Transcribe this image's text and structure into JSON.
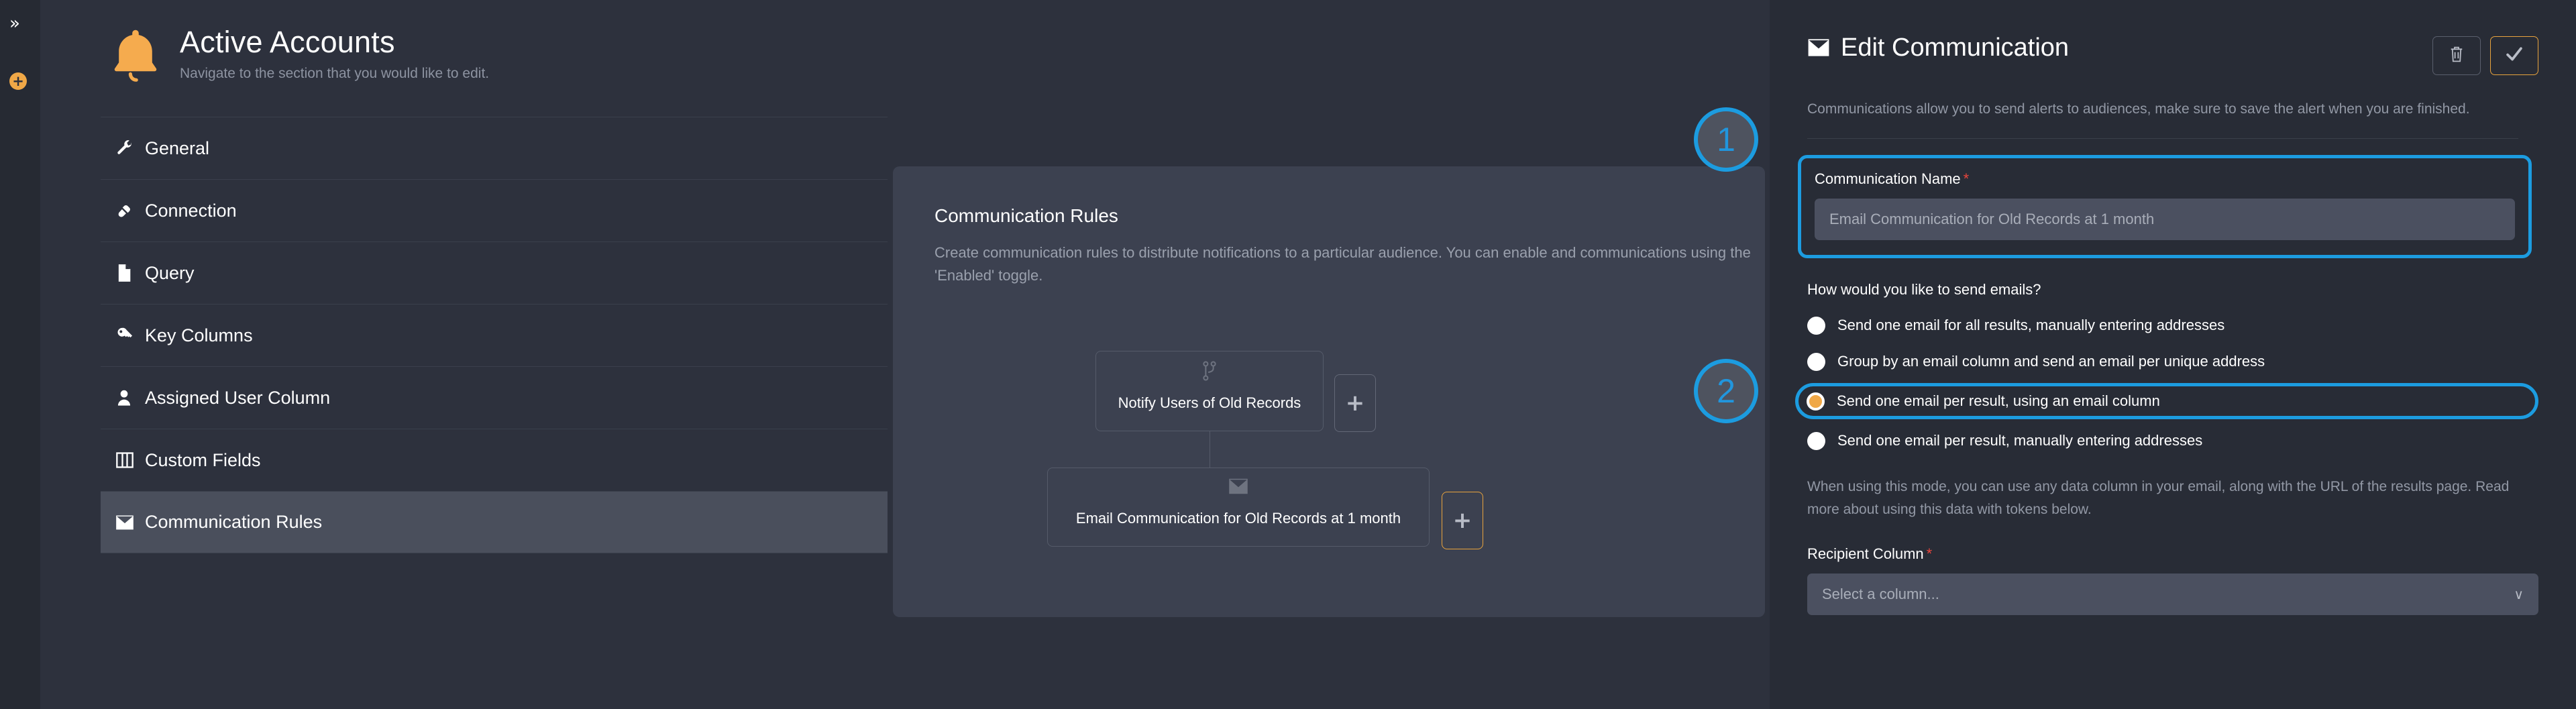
{
  "rail": {
    "collapse_icon": "double-chevron-right-icon",
    "collapse_glyph": "»",
    "add_icon": "plus-circle-icon",
    "add_glyph": "+"
  },
  "header": {
    "icon": "bell-icon",
    "icon_glyph": "🔔",
    "title": "Active Accounts",
    "subtitle": "Navigate to the section that you would like to edit."
  },
  "sidebar": {
    "items": [
      {
        "label": "General",
        "icon": "wrench-icon",
        "active": false
      },
      {
        "label": "Connection",
        "icon": "plug-icon",
        "active": false
      },
      {
        "label": "Query",
        "icon": "file-icon",
        "active": false
      },
      {
        "label": "Key Columns",
        "icon": "key-icon",
        "active": false
      },
      {
        "label": "Assigned User Column",
        "icon": "user-icon",
        "active": false
      },
      {
        "label": "Custom Fields",
        "icon": "columns-icon",
        "active": false
      },
      {
        "label": "Communication Rules",
        "icon": "envelope-icon",
        "active": true
      }
    ]
  },
  "middle": {
    "title": "Communication Rules",
    "description": "Create communication rules to distribute notifications to a particular audience. You can enable and communications using the 'Enabled' toggle.",
    "tree": {
      "parent": {
        "label": "Notify Users of Old Records",
        "icon": "branch-icon"
      },
      "child": {
        "label": "Email Communication for Old Records at 1 month",
        "icon": "envelope-icon"
      },
      "add_parent_label": "+",
      "add_child_label": "+"
    }
  },
  "right": {
    "icon": "envelope-icon",
    "title": "Edit Communication",
    "description": "Communications allow you to send alerts to audiences, make sure to save the alert when you are finished.",
    "delete_icon": "trash-icon",
    "save_icon": "check-icon",
    "communication_name": {
      "label": "Communication Name",
      "required_marker": "*",
      "value": "Email Communication for Old Records at 1 month",
      "placeholder": "Email Communication for Old Records at 1 month"
    },
    "send_mode": {
      "question": "How would you like to send emails?",
      "options": [
        {
          "label": "Send one email for all results, manually entering addresses",
          "selected": false
        },
        {
          "label": "Group by an email column and send an email per unique address",
          "selected": false
        },
        {
          "label": "Send one email per result, using an email column",
          "selected": true
        },
        {
          "label": "Send one email per result, manually entering addresses",
          "selected": false
        }
      ]
    },
    "mode_note": "When using this mode, you can use any data column in your email, along with the URL of the results page. Read more about using this data with tokens below.",
    "recipient_column": {
      "label": "Recipient Column",
      "required_marker": "*",
      "placeholder": "Select a column...",
      "value": "Select a column...",
      "caret_icon": "chevron-down-icon",
      "caret_glyph": "∨"
    }
  },
  "annotations": {
    "badges": [
      {
        "number": "1"
      },
      {
        "number": "2"
      }
    ],
    "highlight_color": "#1c9ce0",
    "accent_color": "#f0a847"
  }
}
